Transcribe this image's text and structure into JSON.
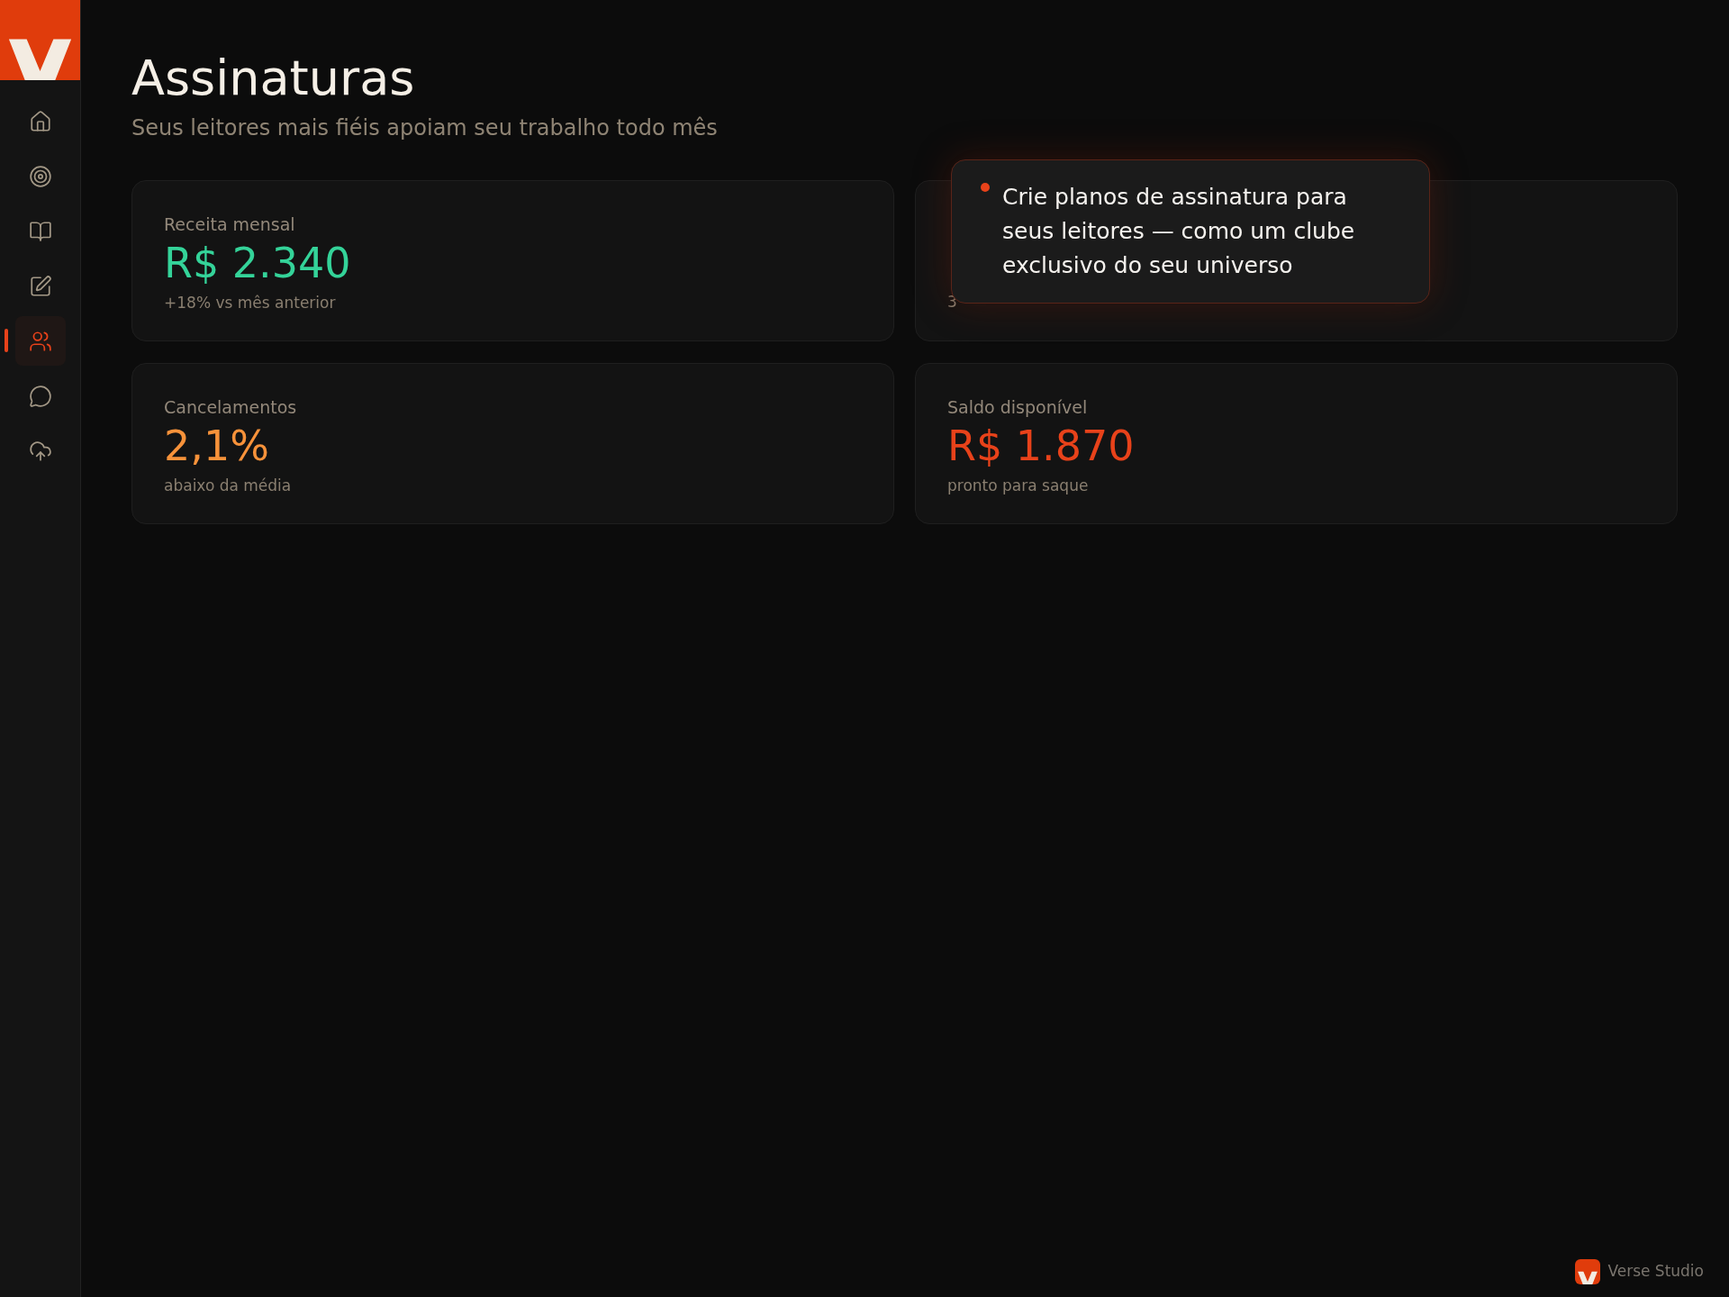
{
  "sidebar": {
    "items": [
      {
        "selected": false
      },
      {
        "selected": false
      },
      {
        "selected": false
      },
      {
        "selected": false
      },
      {
        "selected": true
      },
      {
        "selected": false
      },
      {
        "selected": false
      }
    ]
  },
  "header": {
    "title": "Assinaturas",
    "subtitle": "Seus leitores mais fiéis apoiam seu trabalho todo mês"
  },
  "cards": [
    {
      "label": "Receita mensal",
      "value": "R$ 2.340",
      "note": "+18% vs mês anterior",
      "color": "#34d399"
    },
    {
      "note": "3"
    },
    {
      "label": "Cancelamentos",
      "value": "2,1%",
      "note": "abaixo da média",
      "color": "#f7923a"
    },
    {
      "label": "Saldo disponível",
      "value": "R$ 1.870",
      "note": "pronto para saque",
      "color": "#e8421a"
    }
  ],
  "tooltip": {
    "text": "Crie planos de assinatura para seus leitores — como um clube exclusivo do seu universo"
  },
  "brand": {
    "name": "Verse Studio"
  }
}
